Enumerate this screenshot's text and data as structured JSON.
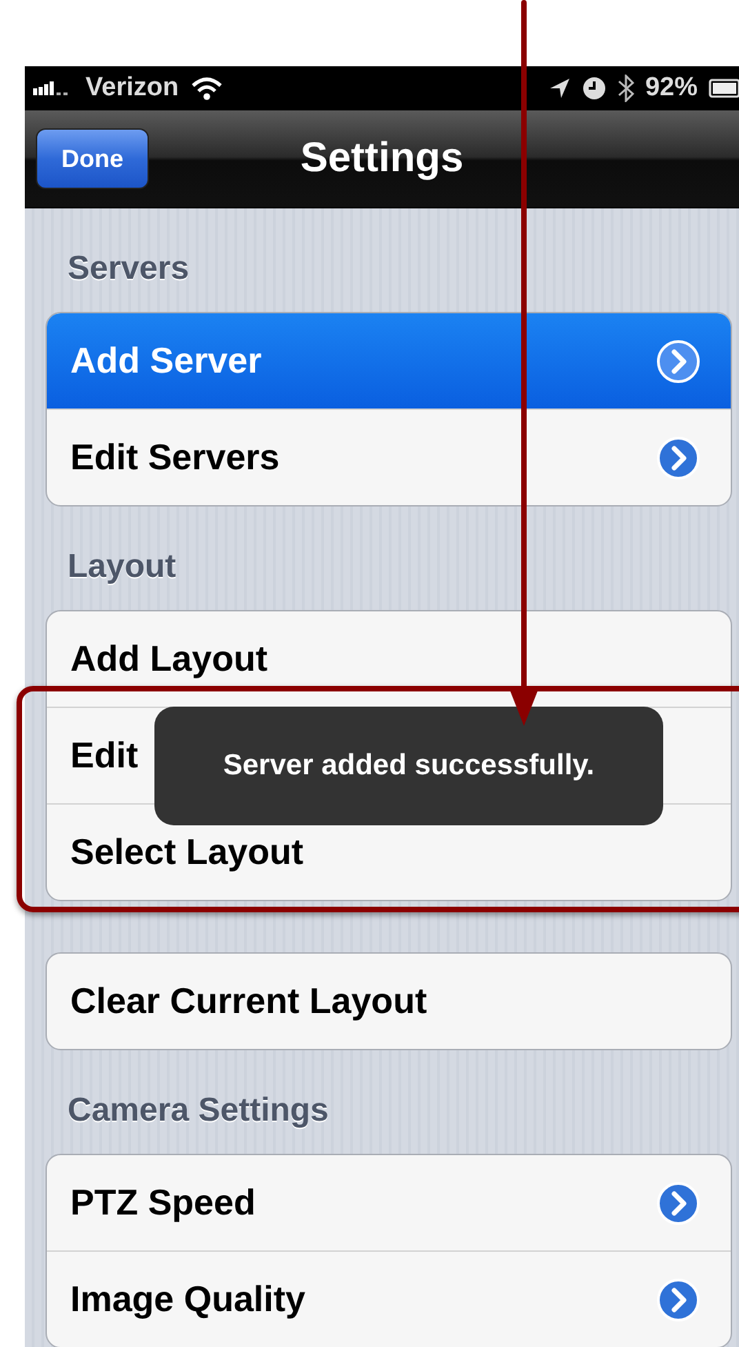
{
  "status_bar": {
    "carrier": "Verizon",
    "battery": "92%"
  },
  "nav_bar": {
    "button": "Done",
    "title": "Settings"
  },
  "sections": [
    {
      "header": "Servers",
      "rows": [
        {
          "label": "Add Server",
          "selected": true,
          "disclosure": true
        },
        {
          "label": "Edit Servers",
          "selected": false,
          "disclosure": true
        }
      ]
    },
    {
      "header": "Layout",
      "rows": [
        {
          "label": "Add Layout",
          "selected": false,
          "disclosure": false
        },
        {
          "label": "Edit",
          "selected": false,
          "disclosure": false
        },
        {
          "label": "Select Layout",
          "selected": false,
          "disclosure": false
        }
      ]
    },
    {
      "rows": [
        {
          "label": "Clear Current Layout",
          "selected": false,
          "disclosure": false
        }
      ]
    },
    {
      "header": "Camera Settings",
      "rows": [
        {
          "label": "PTZ Speed",
          "selected": false,
          "disclosure": true
        },
        {
          "label": "Image Quality",
          "selected": false,
          "disclosure": true
        }
      ]
    }
  ],
  "toast": {
    "message": "Server added successfully."
  }
}
